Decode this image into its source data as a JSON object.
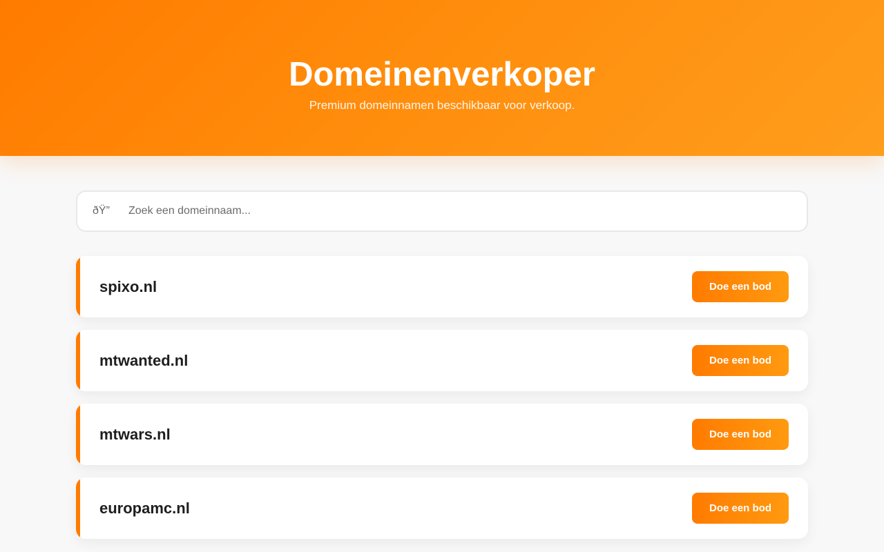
{
  "header": {
    "title": "Domeinenverkoper",
    "subtitle": "Premium domeinnamen beschikbaar voor verkoop."
  },
  "search": {
    "icon_text": "ðŸ”",
    "icon": "search-icon",
    "placeholder": "Zoek een domeinnaam...",
    "value": ""
  },
  "domains": [
    {
      "name": "spixo.nl",
      "button_label": "Doe een bod"
    },
    {
      "name": "mtwanted.nl",
      "button_label": "Doe een bod"
    },
    {
      "name": "mtwars.nl",
      "button_label": "Doe een bod"
    },
    {
      "name": "europamc.nl",
      "button_label": "Doe een bod"
    }
  ],
  "colors": {
    "accent": "#ff7b00",
    "accent_light": "#ff9a10",
    "background": "#f8f8f8",
    "card": "#ffffff",
    "text": "#1e1e1e"
  }
}
